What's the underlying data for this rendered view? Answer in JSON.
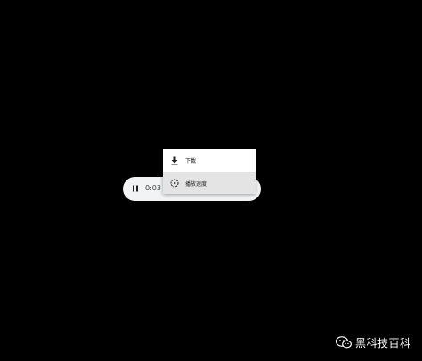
{
  "player": {
    "state": "playing",
    "time_text": "0:03 /"
  },
  "menu": {
    "items": [
      {
        "label": "下載",
        "icon": "download-icon"
      },
      {
        "label": "播放速度",
        "icon": "playback-speed-icon"
      }
    ]
  },
  "watermark": {
    "text": "黑科技百科",
    "logo": "wechat-logo"
  },
  "colors": {
    "background": "#000000",
    "player_bg": "#f1f3f4",
    "menu_bg": "#ffffff",
    "menu_hover": "#e4e4e4"
  }
}
